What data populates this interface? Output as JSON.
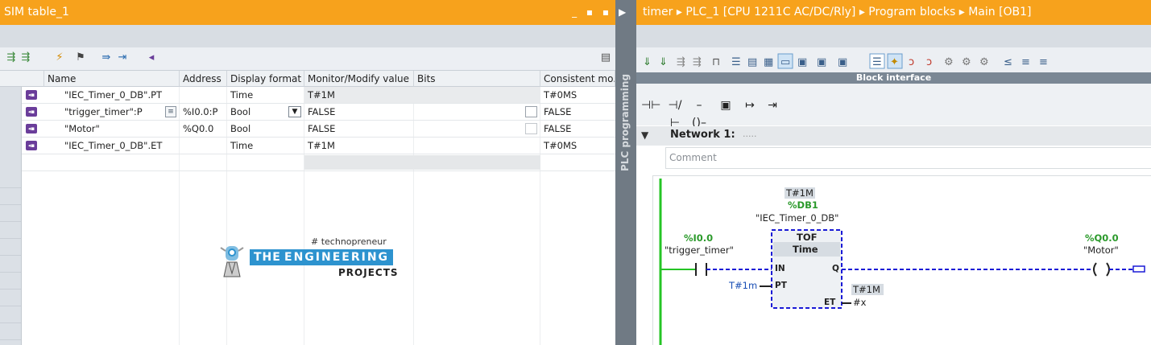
{
  "sim_table": {
    "title": "SIM table_1",
    "window_controls": "_ ▪ ▪",
    "toolbar_icons": [
      "insert-row-icon",
      "add-row-icon",
      "modify-now-icon",
      "modify-trigger-icon",
      "monitor-all-icon",
      "monitor-once-icon",
      "tag-icon"
    ],
    "columns": [
      "Name",
      "Address",
      "Display format",
      "Monitor/Modify value",
      "Bits",
      "Consistent mo..."
    ],
    "rows": [
      {
        "name": "\"IEC_Timer_0_DB\".PT",
        "address": "",
        "format": "Time",
        "value": "T#1M",
        "bits": "",
        "consistent": "T#0MS"
      },
      {
        "name": "\"trigger_timer\":P",
        "address": "%I0.0:P",
        "format": "Bool",
        "value": "FALSE",
        "bits": "",
        "consistent": "FALSE"
      },
      {
        "name": "\"Motor\"",
        "address": "%Q0.0",
        "format": "Bool",
        "value": "FALSE",
        "bits": "",
        "consistent": "FALSE"
      },
      {
        "name": "\"IEC_Timer_0_DB\".ET",
        "address": "",
        "format": "Time",
        "value": "T#1M",
        "bits": "",
        "consistent": "T#0MS"
      }
    ]
  },
  "watermark": {
    "hashtag": "# technopreneur",
    "the": "THE",
    "engineering": "ENGINEERING",
    "projects": "PROJECTS"
  },
  "side_panel": {
    "label": "PLC programming"
  },
  "plc": {
    "breadcrumb": "timer ▸ PLC_1 [CPU 1211C AC/DC/Rly] ▸ Program blocks ▸ Main [OB1]",
    "block_interface": "Block interface",
    "network_title": "Network 1:",
    "network_dots": ".....",
    "comment_placeholder": "Comment",
    "ladder": {
      "block_pt_value": "T#1M",
      "db_address": "%DB1",
      "db_name": "\"IEC_Timer_0_DB\"",
      "block_type": "TOF",
      "block_subtype": "Time",
      "in_pin": "IN",
      "q_pin": "Q",
      "pt_pin": "PT",
      "et_pin": "ET",
      "contact_address": "%I0.0",
      "contact_tag": "\"trigger_timer\"",
      "pt_input": "T#1m",
      "et_value": "T#1M",
      "et_output": "#x",
      "coil_address": "%Q0.0",
      "coil_tag": "\"Motor\""
    }
  },
  "colors": {
    "title_orange": "#f7a21c",
    "rung_green": "#25c425",
    "wire_blue": "#1a1ad6",
    "tag_purple": "#6a3d9a"
  }
}
